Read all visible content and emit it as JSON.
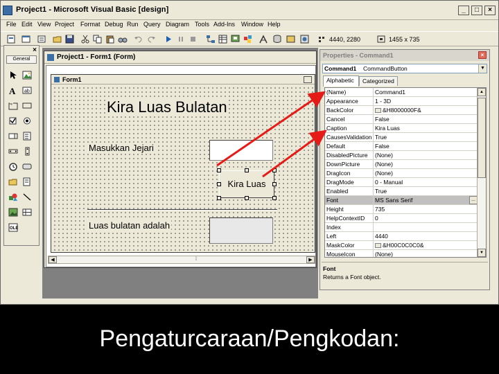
{
  "window": {
    "title": "Project1 - Microsoft Visual Basic [design]",
    "minimize": "_",
    "maximize": "□",
    "close": "×"
  },
  "menu": [
    "File",
    "Edit",
    "View",
    "Project",
    "Format",
    "Debug",
    "Run",
    "Query",
    "Diagram",
    "Tools",
    "Add-Ins",
    "Window",
    "Help"
  ],
  "toolbar": {
    "position_readout": "4440, 2280",
    "size_readout": "1455 x 735"
  },
  "toolbox": {
    "tab": "General",
    "close": "×"
  },
  "project_window": {
    "title": "Project1 - Form1 (Form)"
  },
  "form": {
    "title": "Form1",
    "title_label": "Kira Luas Bulatan",
    "input_label": "Masukkan Jejari",
    "button_label": "Kira Luas",
    "output_label": "Luas bulatan adalah"
  },
  "properties": {
    "title": "Properties - Command1",
    "object_name": "Command1",
    "object_type": "CommandButton",
    "tabs": [
      "Alphabetic",
      "Categorized"
    ],
    "rows": [
      {
        "name": "(Name)",
        "value": "Command1"
      },
      {
        "name": "Appearance",
        "value": "1 - 3D"
      },
      {
        "name": "BackColor",
        "value": "&H8000000F&",
        "swatch": true
      },
      {
        "name": "Cancel",
        "value": "False"
      },
      {
        "name": "Caption",
        "value": "Kira Luas"
      },
      {
        "name": "CausesValidation",
        "value": "True"
      },
      {
        "name": "Default",
        "value": "False"
      },
      {
        "name": "DisabledPicture",
        "value": "(None)"
      },
      {
        "name": "DownPicture",
        "value": "(None)"
      },
      {
        "name": "DragIcon",
        "value": "(None)"
      },
      {
        "name": "DragMode",
        "value": "0 - Manual"
      },
      {
        "name": "Enabled",
        "value": "True"
      },
      {
        "name": "Font",
        "value": "MS Sans Serif",
        "selected": true
      },
      {
        "name": "Height",
        "value": "735"
      },
      {
        "name": "HelpContextID",
        "value": "0"
      },
      {
        "name": "Index",
        "value": ""
      },
      {
        "name": "Left",
        "value": "4440"
      },
      {
        "name": "MaskColor",
        "value": "&H00C0C0C0&",
        "swatch": true
      },
      {
        "name": "MouseIcon",
        "value": "(None)"
      }
    ],
    "description_title": "Font",
    "description_text": "Returns a Font object."
  },
  "slide_caption": "Pengaturcaraan/Pengkodan:",
  "colors": {
    "arrow": "#e41b17",
    "chrome": "#ece9d8"
  }
}
